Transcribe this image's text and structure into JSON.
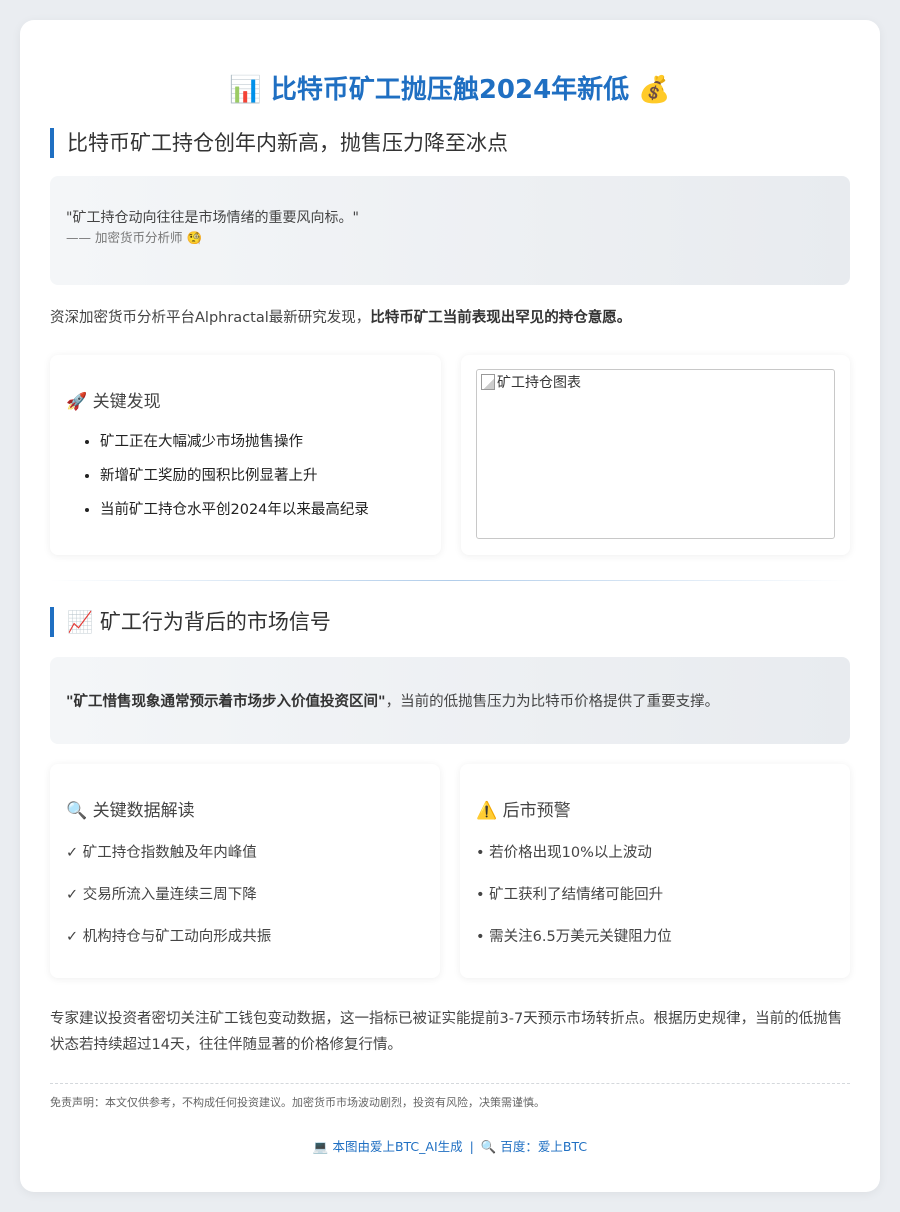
{
  "header": {
    "icon_left": "📊",
    "title": "比特币矿工抛压触2024年新低",
    "icon_right": "💰"
  },
  "section1": {
    "heading": "比特币矿工持仓创年内新高，抛售压力降至冰点",
    "quote": {
      "text": "\"矿工持仓动向往往是市场情绪的重要风向标。\"",
      "source": "—— 加密货币分析师",
      "source_icon": "🧐"
    },
    "intro_plain": "资深加密货币分析平台Alphractal最新研究发现，",
    "intro_bold": "比特币矿工当前表现出罕见的持仓意愿。",
    "findings": {
      "icon": "🚀",
      "heading": "关键发现",
      "items": [
        "矿工正在大幅减少市场抛售操作",
        "新增矿工奖励的囤积比例显著上升",
        "当前矿工持仓水平创2024年以来最高纪录"
      ]
    },
    "image_alt": "矿工持仓图表"
  },
  "section2": {
    "icon": "📈",
    "heading": "矿工行为背后的市场信号",
    "signal_bold": "\"矿工惜售现象通常预示着市场步入价值投资区间\"",
    "signal_plain": "，当前的低抛售压力为比特币价格提供了重要支撑。",
    "data_box": {
      "icon": "🔍",
      "heading": "关键数据解读",
      "items": [
        "✓ 矿工持仓指数触及年内峰值",
        "✓ 交易所流入量连续三周下降",
        "✓ 机构持仓与矿工动向形成共振"
      ]
    },
    "warning_box": {
      "icon": "⚠️",
      "heading": "后市预警",
      "items": [
        "• 若价格出现10%以上波动",
        "• 矿工获利了结情绪可能回升",
        "• 需关注6.5万美元关键阻力位"
      ]
    }
  },
  "outro": "专家建议投资者密切关注矿工钱包变动数据，这一指标已被证实能提前3-7天预示市场转折点。根据历史规律，当前的低抛售状态若持续超过14天，往往伴随显著的价格修复行情。",
  "disclaimer": "免责声明：本文仅供参考，不构成任何投资建议。加密货币市场波动剧烈，投资有风险，决策需谨慎。",
  "footer": {
    "icon1": "💻",
    "text1": "本图由爱上BTC_AI生成",
    "separator": "|",
    "icon2": "🔍",
    "text2": "百度：爱上BTC"
  },
  "colors": {
    "accent": "#1f6fc2",
    "background": "#eaedf1"
  }
}
